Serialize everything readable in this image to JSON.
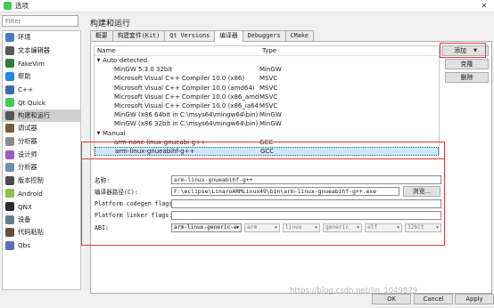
{
  "window": {
    "title": "选项"
  },
  "filter": {
    "placeholder": "Filter"
  },
  "sidebar": {
    "items": [
      {
        "label": "环境",
        "icon": "monitor-icon",
        "color": "#4a7bbf"
      },
      {
        "label": "文本编辑器",
        "icon": "text-editor-icon",
        "color": "#5a5a5a"
      },
      {
        "label": "FakeVim",
        "icon": "fakevim-icon",
        "color": "#2e7d32"
      },
      {
        "label": "帮助",
        "icon": "help-icon",
        "color": "#1e88e5"
      },
      {
        "label": "C++",
        "icon": "cpp-icon",
        "color": "#3c6db0"
      },
      {
        "label": "Qt Quick",
        "icon": "qtquick-icon",
        "color": "#41cd52"
      },
      {
        "label": "构建和运行",
        "icon": "build-run-icon",
        "color": "#555555"
      },
      {
        "label": "调试器",
        "icon": "debugger-icon",
        "color": "#7b5a3c"
      },
      {
        "label": "分析器",
        "icon": "analyzer-icon",
        "color": "#8a8a8a"
      },
      {
        "label": "设计师",
        "icon": "designer-icon",
        "color": "#a05ac8"
      },
      {
        "label": "分析器",
        "icon": "analyzer2-icon",
        "color": "#6a8fb5"
      },
      {
        "label": "版本控制",
        "icon": "version-control-icon",
        "color": "#4a4a4a"
      },
      {
        "label": "Android",
        "icon": "android-icon",
        "color": "#8bc34a"
      },
      {
        "label": "QNX",
        "icon": "qnx-icon",
        "color": "#2b2b2b"
      },
      {
        "label": "设备",
        "icon": "devices-icon",
        "color": "#607d8b"
      },
      {
        "label": "代码粘贴",
        "icon": "code-paste-icon",
        "color": "#6d4c41"
      },
      {
        "label": "Qbs",
        "icon": "qbs-icon",
        "color": "#5c6bc0"
      }
    ]
  },
  "main": {
    "title": "构建和运行",
    "tabs": [
      "概要",
      "构建套件(Kit)",
      "Qt Versions",
      "编译器",
      "Debuggers",
      "CMake"
    ],
    "active_tab": "编译器"
  },
  "compiler_tree": {
    "headers": [
      "Name",
      "Type"
    ],
    "groups": [
      {
        "label": "Auto-detected",
        "rows": [
          [
            "MinGW 5.3.0 32bit",
            "MinGW"
          ],
          [
            "Microsoft Visual C++ Compiler 10.0 (x86)",
            "MSVC"
          ],
          [
            "Microsoft Visual C++ Compiler 10.0 (amd64)",
            "MSVC"
          ],
          [
            "Microsoft Visual C++ Compiler 10.0 (x86_amd64)",
            "MSVC"
          ],
          [
            "Microsoft Visual C++ Compiler 10.0 (x86_ia64)",
            "MSVC"
          ],
          [
            "MinGW (x86 64bit in C:\\msys64\\mingw64\\bin)",
            "MinGW"
          ],
          [
            "MinGW (x86 32bit in C:\\msys64\\mingw64\\bin)",
            "MinGW"
          ]
        ]
      },
      {
        "label": "Manual",
        "rows": [
          [
            "arm-none-linux-gnueabi-g++",
            "GCC"
          ],
          [
            "arm-linux-gnueabihf-g++",
            "GCC"
          ]
        ]
      }
    ]
  },
  "side_buttons": {
    "add": "添加",
    "clone": "克隆",
    "remove": "删除"
  },
  "details": {
    "name_label": "名称:",
    "name_value": "arm-linux-gnueabihf-g++",
    "path_label": "编译器路径(C):",
    "path_value": "F:\\eclipse\\LinaroARMLinux49\\bin\\arm-linux-gnueabihf-g++.exe",
    "browse_label": "浏览...",
    "codegen_label": "Platform codegen flags:",
    "codegen_value": "",
    "linker_label": "Platform linker flags:",
    "linker_value": "",
    "abi_label": "ABI:",
    "abi_values": [
      "arm-linux-generic-e",
      "arm",
      "linux",
      "generic",
      "elf",
      "32bit"
    ]
  },
  "footer": {
    "ok": "OK",
    "cancel": "Cancel",
    "apply": "Apply"
  },
  "watermark": "https://blog.csdn.net/lin_1049879"
}
